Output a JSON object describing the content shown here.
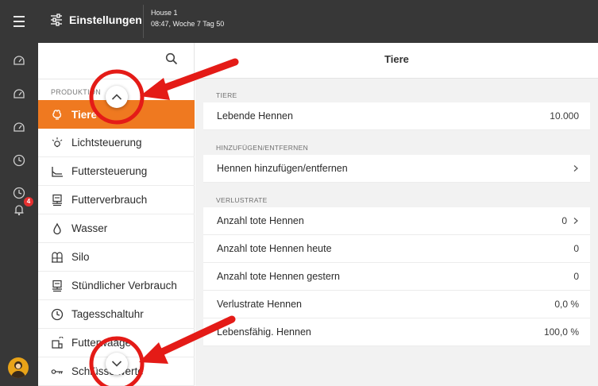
{
  "header": {
    "title": "Einstellungen",
    "house": "House 1",
    "time": "08:47, Woche 7 Tag 50"
  },
  "rail": {
    "badge_count": "4"
  },
  "sidebar": {
    "section": "PRODUKTION",
    "items": [
      {
        "label": "Tiere",
        "icon": "hen-icon"
      },
      {
        "label": "Lichtsteuerung",
        "icon": "light-icon"
      },
      {
        "label": "Futtersteuerung",
        "icon": "feed-control-icon"
      },
      {
        "label": "Futterverbrauch",
        "icon": "scale-icon"
      },
      {
        "label": "Wasser",
        "icon": "water-drop-icon"
      },
      {
        "label": "Silo",
        "icon": "silo-icon"
      },
      {
        "label": "Stündlicher Verbrauch",
        "icon": "scale-icon"
      },
      {
        "label": "Tagesschaltuhr",
        "icon": "clock-icon"
      },
      {
        "label": "Futterwaage",
        "icon": "feed-scale-icon"
      },
      {
        "label": "Schlüsselwerte",
        "icon": "key-icon"
      }
    ]
  },
  "main": {
    "title": "Tiere",
    "groups": {
      "tiere": "TIERE",
      "hinzu": "HINZUFÜGEN/ENTFERNEN",
      "verlust": "VERLUSTRATE"
    },
    "rows": [
      {
        "label": "Lebende Hennen",
        "value": "10.000"
      },
      {
        "label": "Hennen hinzufügen/entfernen",
        "value": ""
      },
      {
        "label": "Anzahl tote Hennen",
        "value": "0"
      },
      {
        "label": "Anzahl tote Hennen heute",
        "value": "0"
      },
      {
        "label": "Anzahl tote Hennen gestern",
        "value": "0"
      },
      {
        "label": "Verlustrate Hennen",
        "value": "0,0 %"
      },
      {
        "label": "Lebensfähig. Hennen",
        "value": "100,0 %"
      }
    ]
  },
  "colors": {
    "accent": "#ef7920",
    "topbar": "#373737",
    "annotation": "#e41b17"
  }
}
